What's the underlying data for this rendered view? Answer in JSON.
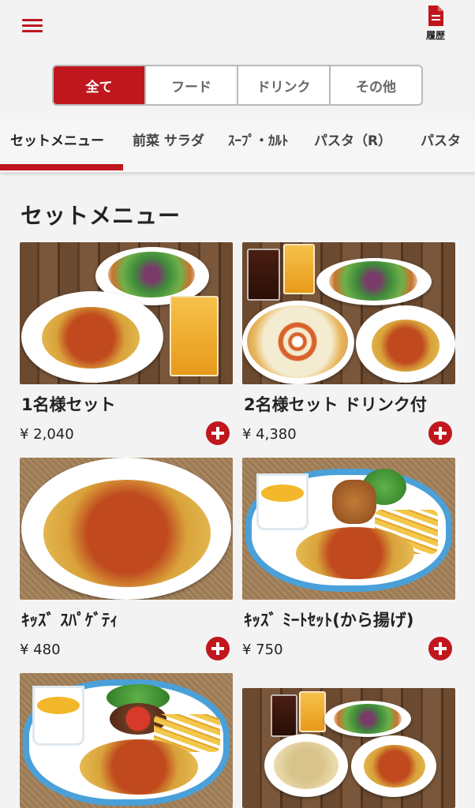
{
  "header": {
    "menu_icon": "hamburger-menu-icon",
    "history_icon": "document-icon",
    "history_label": "履歴",
    "accent_color": "#c0171e"
  },
  "segment": {
    "items": [
      "全て",
      "フード",
      "ドリンク",
      "その他"
    ],
    "selected": "全て"
  },
  "categories": {
    "items": [
      "セットメニュー",
      "前菜 サラダ",
      "ｽｰﾌﾟ・ｶﾙﾄ",
      "パスタ（R）",
      "パスタ"
    ],
    "selected": "セットメニュー"
  },
  "section": {
    "title": "セットメニュー"
  },
  "products": [
    {
      "name": "1名様セット",
      "price": "¥ 2,040"
    },
    {
      "name": "2名様セット ドリンク付",
      "price": "¥ 4,380"
    },
    {
      "name": "ｷｯｽﾞ ｽﾊﾟｹﾞﾃｨ",
      "price": "¥ 480"
    },
    {
      "name": "ｷｯｽﾞ ﾐｰﾄｾｯﾄ(から揚げ)",
      "price": "¥ 750"
    }
  ],
  "add_icon": "plus-circle-icon"
}
